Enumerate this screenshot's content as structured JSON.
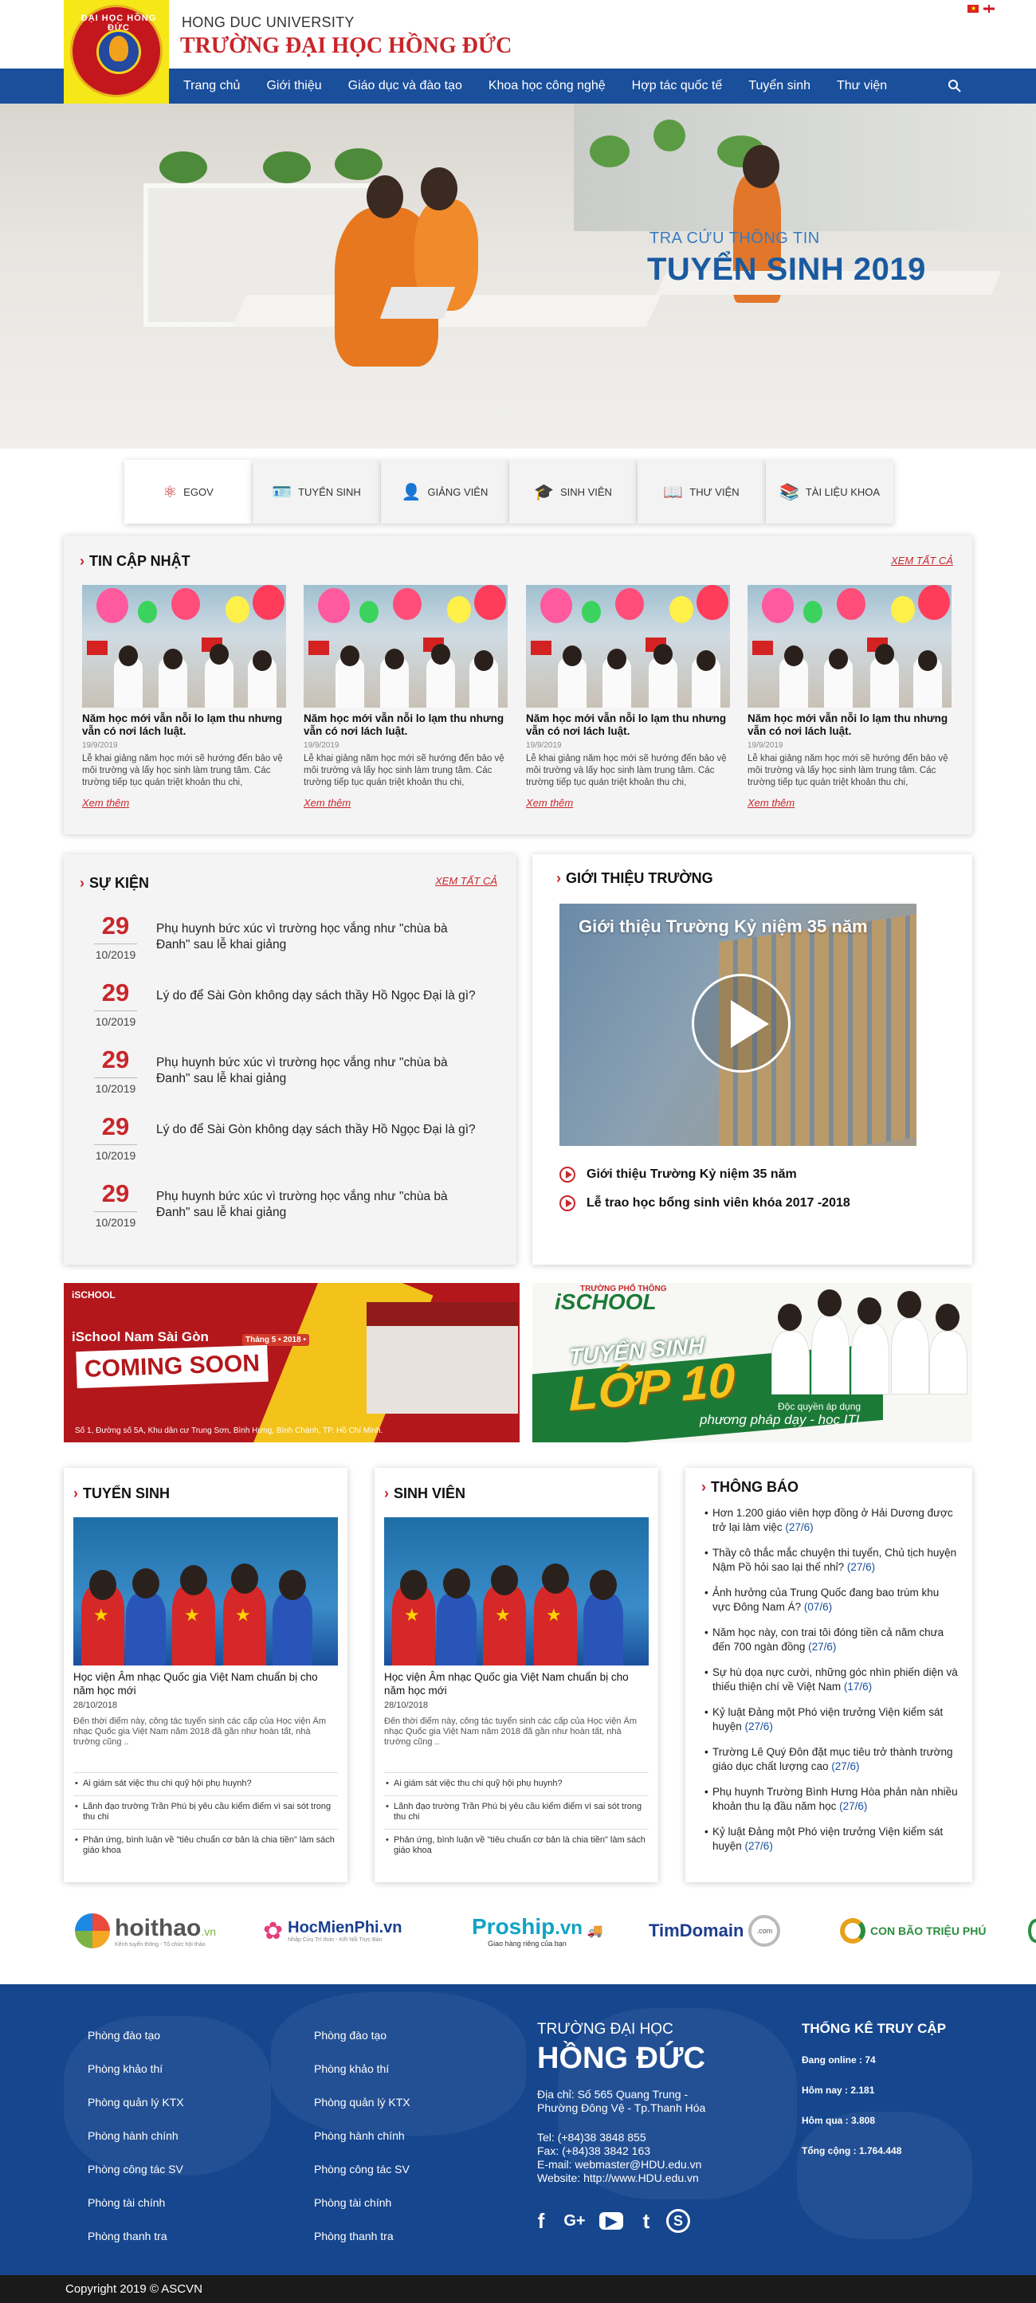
{
  "header": {
    "logo_text": "ĐẠI HỌC HỒNG ĐỨC",
    "university_en": "HONG DUC UNIVERSITY",
    "university_vi": "TRƯỜNG ĐẠI HỌC HỒNG ĐỨC",
    "nav": [
      "Trang chủ",
      "Giới thiệu",
      "Giáo dục và đào tạo",
      "Khoa học công nghệ",
      "Hợp tác quốc tế",
      "Tuyển sinh",
      "Thư viện"
    ],
    "nav_bg": "#1a4f9c",
    "accent": "#c8262b"
  },
  "hero": {
    "subtitle": "TRA CỨU THÔNG TIN",
    "title": "TUYỂN SINH 2019"
  },
  "quick_links": [
    {
      "label": "EGOV",
      "icon": "atom-icon"
    },
    {
      "label": "TUYỂN SINH",
      "icon": "id-card-icon"
    },
    {
      "label": "GIẢNG VIÊN",
      "icon": "teacher-icon"
    },
    {
      "label": "SINH VIÊN",
      "icon": "graduate-icon"
    },
    {
      "label": "THƯ VIỆN",
      "icon": "book-icon"
    },
    {
      "label": "TÀI LIỆU KHOA",
      "icon": "open-book-icon"
    }
  ],
  "news": {
    "title": "TIN CẬP NHẬT",
    "more": "XEM TẤT CẢ",
    "items": [
      {
        "title": "Năm học mới vẫn nỗi lo lạm thu nhưng vẫn có nơi lách luật.",
        "date": "19/9/2019",
        "desc": "Lễ khai giảng năm học mới sẽ hướng đến bảo vệ môi trường và lấy học sinh làm trung tâm. Các trường tiếp tục quán triệt khoản thu chi,",
        "more": "Xem thêm"
      },
      {
        "title": "Năm học mới vẫn nỗi lo lạm thu nhưng vẫn có nơi lách luật.",
        "date": "19/9/2019",
        "desc": "Lễ khai giảng năm học mới sẽ hướng đến bảo vệ môi trường và lấy học sinh làm trung tâm. Các trường tiếp tục quán triệt khoản thu chi,",
        "more": "Xem thêm"
      },
      {
        "title": "Năm học mới vẫn nỗi lo lạm thu nhưng vẫn có nơi lách luật.",
        "date": "19/9/2019",
        "desc": "Lễ khai giảng năm học mới sẽ hướng đến bảo vệ môi trường và lấy học sinh làm trung tâm. Các trường tiếp tục quán triệt khoản thu chi,",
        "more": "Xem thêm"
      },
      {
        "title": "Năm học mới vẫn nỗi lo lạm thu nhưng vẫn có nơi lách luật.",
        "date": "19/9/2019",
        "desc": "Lễ khai giảng năm học mới sẽ hướng đến bảo vệ môi trường và lấy học sinh làm trung tâm. Các trường tiếp tục quán triệt khoản thu chi,",
        "more": "Xem thêm"
      }
    ]
  },
  "events": {
    "title": "SỰ KIỆN",
    "more": "XEM TẤT CẢ",
    "items": [
      {
        "day": "29",
        "month": "10/2019",
        "text": "Phụ huynh bức xúc vì trường học vắng như \"chùa bà Đanh\" sau lễ khai giảng"
      },
      {
        "day": "29",
        "month": "10/2019",
        "text": "Lý do để Sài Gòn không dạy sách thầy Hồ Ngọc Đại là gì?"
      },
      {
        "day": "29",
        "month": "10/2019",
        "text": "Phụ huynh bức xúc vì trường học vắng như \"chùa bà Đanh\" sau lễ khai giảng"
      },
      {
        "day": "29",
        "month": "10/2019",
        "text": "Lý do để Sài Gòn không dạy sách thầy Hồ Ngọc Đại là gì?"
      },
      {
        "day": "29",
        "month": "10/2019",
        "text": "Phụ huynh bức xúc vì trường học vắng như \"chùa bà Đanh\" sau lễ khai giảng"
      }
    ]
  },
  "intro": {
    "title": "GIỚI THIỆU TRƯỜNG",
    "video_title": "Giới thiệu Trường Kỷ niệm 35 năm",
    "links": [
      "Giới thiệu Trường Kỷ niệm 35 năm",
      "Lễ trao học bổng sinh viên khóa 2017 -2018"
    ]
  },
  "banners": {
    "left": {
      "brand": "iSCHOOL",
      "name": "iSchool Nam Sài Gòn",
      "badge": "Tháng 5 • 2018 •",
      "cta": "COMING SOON",
      "address": "Số 1, Đường số 5A, Khu dân cư Trung Sơn, Bình Hưng, Bình Chánh, TP. Hồ Chí Minh."
    },
    "right": {
      "brand": "iSCHOOL",
      "top": "TRƯỜNG PHỔ THÔNG",
      "headline": "TUYỂN SINH",
      "grade": "LỚP 10",
      "tagline": "Độc quyền áp dụng",
      "method": "phương pháp dạy - học ITL"
    }
  },
  "admissions": {
    "title": "TUYỂN SINH",
    "headline": "Học viện Âm nhạc Quốc gia Việt Nam chuẩn bị cho năm học mới",
    "date": "28/10/2018",
    "desc": "Đến thời điểm này, công tác tuyển sinh các cấp của Học viện Âm nhạc Quốc gia Việt Nam năm 2018 đã gần như hoàn tất, nhà trường cũng ..",
    "list": [
      "Ai giám sát việc thu chi quỹ hội phụ huynh?",
      "Lãnh đạo trường Trần Phú bị yêu cầu kiểm điểm vì sai sót trong thu chi",
      "Phản ứng, bình luận về \"tiêu chuẩn cơ bản là chia tiền\" làm sách giáo khoa"
    ]
  },
  "students": {
    "title": "SINH VIÊN",
    "headline": "Học viện Âm nhạc Quốc gia Việt Nam chuẩn bị cho năm học mới",
    "date": "28/10/2018",
    "desc": "Đến thời điểm này, công tác tuyển sinh các cấp của Học viện Âm nhạc Quốc gia Việt Nam năm 2018 đã gần như hoàn tất, nhà trường cũng ..",
    "list": [
      "Ai giám sát việc thu chi quỹ hội phụ huynh?",
      "Lãnh đạo trường Trần Phú bị yêu cầu kiểm điểm vì sai sót trong thu chi",
      "Phản ứng, bình luận về \"tiêu chuẩn cơ bản là chia tiền\" làm sách giáo khoa"
    ]
  },
  "notices": {
    "title": "THÔNG BÁO",
    "items": [
      {
        "text": "Hơn 1.200 giáo viên hợp đồng ở Hải Dương được trở lại làm việc ",
        "date": "(27/6)"
      },
      {
        "text": "Thầy cô thắc mắc chuyện thi tuyển, Chủ tịch huyện Nậm Pồ hỏi sao lại thế nhỉ? ",
        "date": "(27/6)"
      },
      {
        "text": "Ảnh hưởng của Trung Quốc đang bao trùm khu vực Đông Nam Á? ",
        "date": "(07/6)"
      },
      {
        "text": "Năm học này, con trai tôi đóng tiền cả năm chưa đến 700 ngàn đồng ",
        "date": "(27/6)"
      },
      {
        "text": "Sự hù dọa nực cười, những góc nhìn phiến diện và thiếu thiện chí về Việt Nam ",
        "date": "(17/6)"
      },
      {
        "text": "Kỷ luật Đảng một Phó viện trưởng Viện kiểm sát huyện ",
        "date": "(27/6)"
      },
      {
        "text": "Trường Lê Quý Đôn đặt mục tiêu trở thành trường giáo dục chất lượng cao ",
        "date": "(27/6)"
      },
      {
        "text": "Phụ huynh Trường Bình Hưng Hòa phản nàn nhiều khoản thu lạ đầu năm học ",
        "date": "(27/6)"
      },
      {
        "text": "Kỷ luật Đảng một Phó viện trưởng Viện kiểm sát huyện ",
        "date": "(27/6)"
      }
    ]
  },
  "partners": [
    {
      "name": "hoithao",
      "suffix": ".vn",
      "tag": "Kênh tuyển thông - Tổ chức hội thảo"
    },
    {
      "name": "HocMienPhi",
      "suffix": ".vn",
      "tag": "Nhập Cửu Trí thức - Kết Nối Trực Bản"
    },
    {
      "name": "Proship",
      "suffix": ".vn",
      "tag": "Giao hàng riêng của bạn"
    },
    {
      "name": "TimDomain",
      "suffix": ".com",
      "tag": ""
    },
    {
      "name": "CON BÃO TRIỆU PHÚ",
      "suffix": "",
      "tag": ""
    }
  ],
  "footer": {
    "links_left": [
      "Phòng đào tạo",
      "Phòng khảo thí",
      "Phòng quản lý KTX",
      "Phòng hành chính",
      "Phòng công tác SV",
      "Phòng tài chính",
      "Phòng thanh tra"
    ],
    "links_mid": [
      "Phòng đào tạo",
      "Phòng khảo thí",
      "Phòng quản lý KTX",
      "Phòng hành chính",
      "Phòng công tác SV",
      "Phòng tài chính",
      "Phòng thanh tra"
    ],
    "school_sub": "TRƯỜNG ĐẠI HỌC",
    "school_name": "HỒNG ĐỨC",
    "address": "Địa chỉ: Số 565 Quang Trung - Phường Đông Vệ - Tp.Thanh Hóa",
    "tel": "Tel: (+84)38 3848 855",
    "fax": "Fax: (+84)38 3842 163",
    "email": "E-mail: webmaster@HDU.edu.vn",
    "website": "Website: http://www.HDU.edu.vn",
    "stats_title": "THỐNG KÊ TRUY CẬP",
    "stats": [
      "Đang online : 74",
      "Hôm nay : 2.181",
      "Hôm qua : 3.808",
      "Tổng cộng : 1.764.448"
    ],
    "social": [
      "f",
      "G+",
      "▶",
      "t",
      "S"
    ],
    "copyright": "Copyright  2019 © ASCVN"
  }
}
